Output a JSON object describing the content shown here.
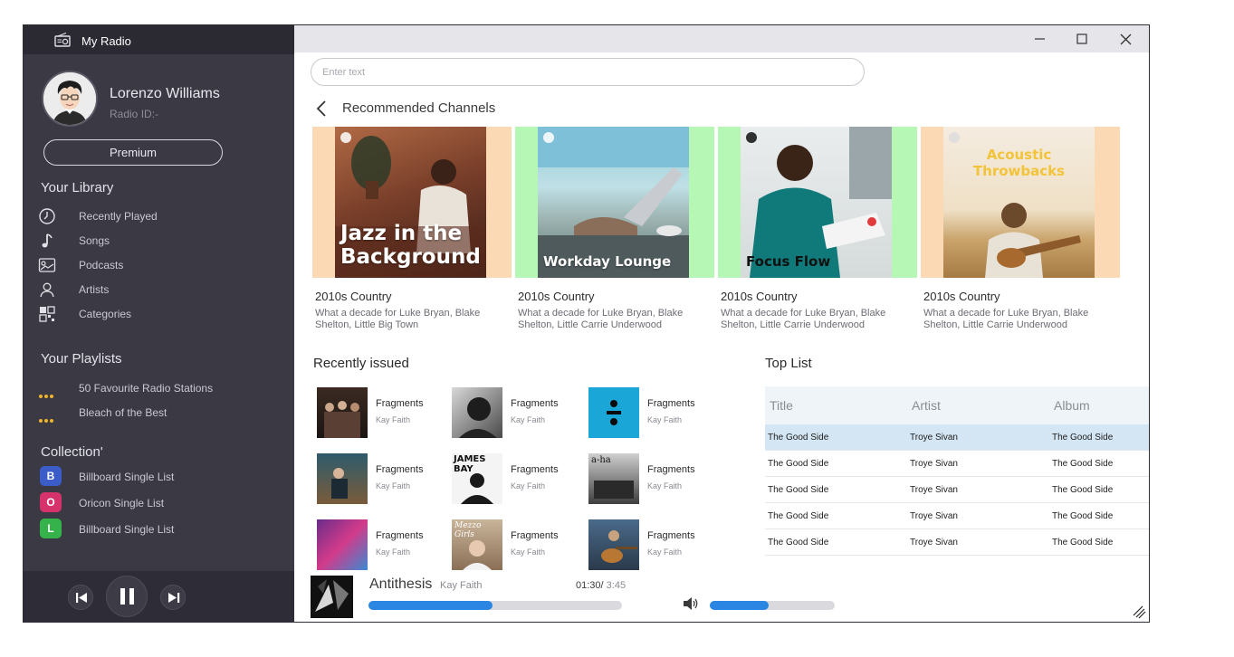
{
  "app": {
    "name": "My Radio"
  },
  "user": {
    "name": "Lorenzo Williams",
    "radio_id": "Radio ID:-",
    "premium_label": "Premium"
  },
  "library": {
    "heading": "Your Library",
    "items": [
      {
        "label": "Recently Played",
        "icon": "clock-icon"
      },
      {
        "label": "Songs",
        "icon": "music-note-icon"
      },
      {
        "label": "Podcasts",
        "icon": "podcast-icon"
      },
      {
        "label": "Artists",
        "icon": "person-icon"
      },
      {
        "label": "Categories",
        "icon": "grid-icon"
      }
    ]
  },
  "playlists": {
    "heading": "Your Playlists",
    "items": [
      {
        "label": "50 Favourite Radio Stations"
      },
      {
        "label": "Bleach of the Best"
      }
    ]
  },
  "collection": {
    "heading": "Collection'",
    "items": [
      {
        "letter": "B",
        "label": "Billboard Single List",
        "color": "#3b5cc9"
      },
      {
        "letter": "O",
        "label": "Oricon Single List",
        "color": "#d6336c"
      },
      {
        "letter": "L",
        "label": "Billboard Single List",
        "color": "#35b34a"
      }
    ]
  },
  "search": {
    "placeholder": "Enter text"
  },
  "recommended": {
    "heading": "Recommended Channels",
    "cards": [
      {
        "cover_text": "Jazz in the Background",
        "cover_line1": "Jazz in the",
        "cover_line2": "Background",
        "title": "2010s Country",
        "desc": "What a decade for Luke Bryan, Blake Shelton, Little Big Town",
        "bg": "#fcd9b5"
      },
      {
        "cover_text": "Workday Lounge",
        "title": "2010s Country",
        "desc": "What a decade for Luke Bryan, Blake Shelton, Little Carrie Underwood",
        "bg": "#b6f7b5"
      },
      {
        "cover_text": "Focus Flow",
        "title": "2010s Country",
        "desc": "What a decade for Luke Bryan, Blake Shelton, Little Carrie Underwood",
        "bg": "#b6f7b5"
      },
      {
        "cover_text": "Acoustic Throwbacks",
        "cover_line1": "Acoustic",
        "cover_line2": "Throwbacks",
        "title": "2010s Country",
        "desc": "What a decade for Luke Bryan, Blake Shelton, Little Carrie Underwood",
        "bg": "#fcd9b5"
      }
    ]
  },
  "recent": {
    "heading": "Recently issued",
    "items": [
      {
        "title": "Fragments",
        "artist": "Kay Faith"
      },
      {
        "title": "Fragments",
        "artist": "Kay Faith"
      },
      {
        "title": "Fragments",
        "artist": "Kay Faith"
      },
      {
        "title": "Fragments",
        "artist": "Kay Faith",
        "cover_text": ""
      },
      {
        "title": "Fragments",
        "artist": "Kay Faith",
        "cover_text": "JAMES BAY"
      },
      {
        "title": "Fragments",
        "artist": "Kay Faith",
        "cover_text": "a-ha"
      },
      {
        "title": "Fragments",
        "artist": "Kay Faith"
      },
      {
        "title": "Fragments",
        "artist": "Kay Faith",
        "cover_text": "Mezzo Girls"
      },
      {
        "title": "Fragments",
        "artist": "Kay Faith"
      }
    ]
  },
  "toplist": {
    "heading": "Top List",
    "columns": [
      "Title",
      "Artist",
      "Album"
    ],
    "rows": [
      [
        "The Good Side",
        "Troye Sivan",
        "The Good Side"
      ],
      [
        "The Good Side",
        "Troye Sivan",
        "The Good Side"
      ],
      [
        "The Good Side",
        "Troye Sivan",
        "The Good Side"
      ],
      [
        "The Good Side",
        "Troye Sivan",
        "The Good Side"
      ],
      [
        "The Good Side",
        "Troye Sivan",
        "The Good Side"
      ]
    ],
    "selected_row": 0
  },
  "player": {
    "title": "Antithesis",
    "artist": "Kay Faith",
    "elapsed": "01:30/",
    "duration": " 3:45",
    "progress": 0.49,
    "volume": 0.47
  },
  "colors": {
    "accent": "#2a86e2",
    "sidebar": "#3a3944",
    "playlist_dot": "#f0b429"
  }
}
